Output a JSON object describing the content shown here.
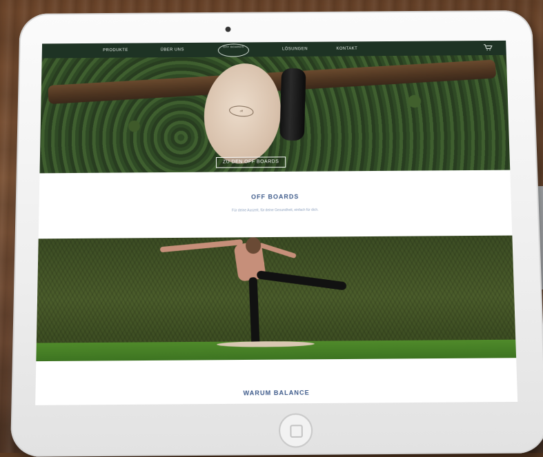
{
  "nav": {
    "items": [
      "PRODUKTE",
      "ÜBER UNS",
      "LÖSUNGEN",
      "KONTAKT"
    ],
    "logo_text": "OFF BOARDS"
  },
  "hero": {
    "button_label": "ZU DEN OFF BOARDS",
    "board_logo": "off"
  },
  "section1": {
    "title": "OFF BOARDS",
    "subtitle": "Für deine Auszeit, für deine Gesundheit, einfach für dich."
  },
  "section2": {
    "title": "WARUM BALANCE"
  },
  "colors": {
    "nav_bg": "#1e3324",
    "accent_text": "#3d5a8a",
    "wood": "#6b4429"
  },
  "icons": {
    "cart": "cart-icon",
    "home": "home-button-icon"
  }
}
